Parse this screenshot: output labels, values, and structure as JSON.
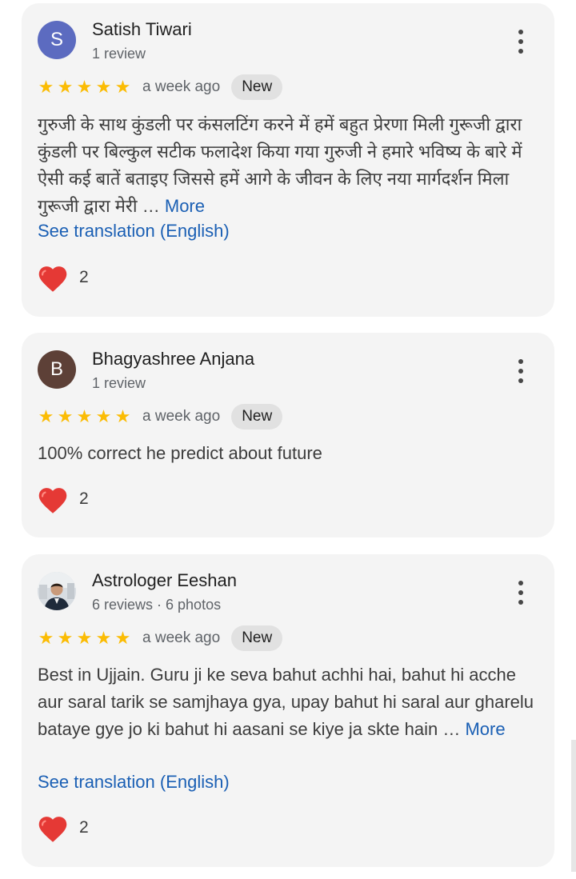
{
  "reviews": [
    {
      "avatar_letter": "S",
      "avatar_color": "#5c6bc0",
      "name": "Satish Tiwari",
      "meta": "1 review",
      "stars": 5,
      "time": "a week ago",
      "badge": "New",
      "text": "गुरुजी के साथ कुंडली पर कंसलटिंग करने में हमें बहुत प्रेरणा मिली गुरूजी द्वारा कुंडली पर बिल्कुल सटीक फलादेश किया गया गुरुजी ने हमारे भविष्य के बारे में ऐसी कई बातें बताइए जिससे हमें आगे के जीवन के लिए नया मार्गदर्शन मिला गुरूजी द्वारा मेरी",
      "ellipsis": "…",
      "more": "More",
      "translate": "See translation (English)",
      "reaction_count": "2"
    },
    {
      "avatar_letter": "B",
      "avatar_color": "#5d4037",
      "name": "Bhagyashree Anjana",
      "meta": "1 review",
      "stars": 5,
      "time": "a week ago",
      "badge": "New",
      "text": "100% correct he predict about future",
      "reaction_count": "2"
    },
    {
      "avatar_icon": "user-photo",
      "name": "Astrologer Eeshan",
      "meta": "6 reviews · 6 photos",
      "stars": 5,
      "time": "a week ago",
      "badge": "New",
      "text": "Best in Ujjain. Guru ji ke seva bahut achhi hai, bahut hi acche aur saral tarik se samjhaya gya, upay bahut hi saral aur gharelu bataye gye jo ki bahut hi aasani se kiye ja skte hain",
      "ellipsis": "…",
      "more": "More",
      "translate": "See translation (English)",
      "reaction_count": "2"
    }
  ],
  "icons": {
    "star": "star-icon",
    "kebab": "more-vert-icon",
    "reaction": "heart-icon"
  },
  "colors": {
    "link": "#1a5fb4",
    "star": "#fbbc04",
    "heart": "#e53935"
  }
}
